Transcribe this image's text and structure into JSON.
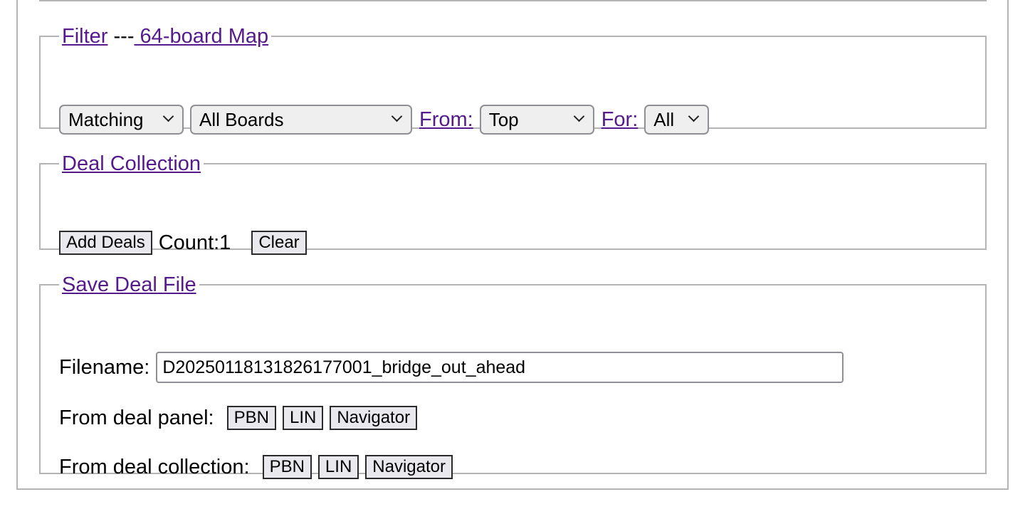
{
  "filter": {
    "legend_link": "Filter",
    "separator": "---",
    "map_link": " 64-board Map",
    "match_select": "Matching",
    "boards_select": "All Boards",
    "from_link": "From:",
    "from_select": "Top",
    "for_link": "For:",
    "for_select": "All"
  },
  "collection": {
    "legend_link": "Deal Collection",
    "add_button": "Add Deals",
    "count_text": "Count:1",
    "clear_button": "Clear"
  },
  "save": {
    "legend_link": "Save Deal File",
    "filename_label": "Filename:",
    "filename_value": "D20250118131826177001_bridge_out_ahead",
    "panel_label": "From deal panel:",
    "collection_label": "From deal collection:",
    "pbn_button": "PBN",
    "lin_button": "LIN",
    "navigator_button": "Navigator"
  },
  "icons": {
    "select_arrow": "chevron-down-icon"
  },
  "colors": {
    "link": "#551a8b",
    "border": "#b4b4b4",
    "select_bg": "#efeff0",
    "button_bg": "#e9e9ed"
  }
}
